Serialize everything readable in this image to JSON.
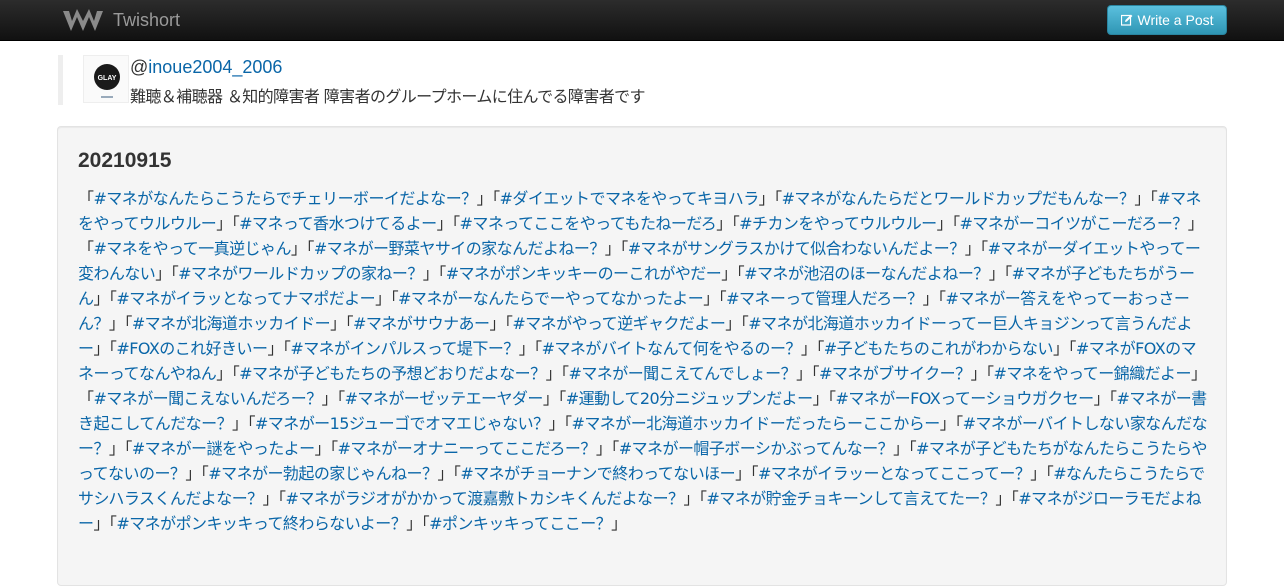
{
  "navbar": {
    "brand": "Twishort",
    "write_button": "Write a Post"
  },
  "profile": {
    "at": "@",
    "username": "inoue2004_2006",
    "bio": "難聴＆補聴器 ＆知的障害者 障害者のグループホームに住んでる障害者です",
    "avatar_text": "GLAY"
  },
  "post": {
    "title": "20210915",
    "segments": [
      {
        "t": "「"
      },
      {
        "t": "#マネがなんたらこうたらでチェリーボーイだよなー？",
        "link": true
      },
      {
        "t": "」「"
      },
      {
        "t": "#ダイエットでマネをやってキヨハラ",
        "link": true
      },
      {
        "t": "」「"
      },
      {
        "t": "#マネがなんたらだとワールドカップだもんなー？",
        "link": true
      },
      {
        "t": "」「"
      },
      {
        "t": "#マネをやってウルウルー",
        "link": true
      },
      {
        "t": "」「"
      },
      {
        "t": "#マネって香水つけてるよー",
        "link": true
      },
      {
        "t": "」「"
      },
      {
        "t": "#マネってここをやってもたねーだろ",
        "link": true
      },
      {
        "t": "」「"
      },
      {
        "t": "#チカンをやってウルウルー",
        "link": true
      },
      {
        "t": "」「"
      },
      {
        "t": "#マネがーコイツがこーだろー？",
        "link": true
      },
      {
        "t": "」「"
      },
      {
        "t": "#マネをやって一真逆じゃん",
        "link": true
      },
      {
        "t": "」「"
      },
      {
        "t": "#マネがー野菜ヤサイの家なんだよねー？",
        "link": true
      },
      {
        "t": "」「"
      },
      {
        "t": "#マネがサングラスかけて似合わないんだよー？",
        "link": true
      },
      {
        "t": "」「"
      },
      {
        "t": "#マネがーダイエットやってー変わんない",
        "link": true
      },
      {
        "t": "」「"
      },
      {
        "t": "#マネがワールドカップの家ねー？",
        "link": true
      },
      {
        "t": "」「"
      },
      {
        "t": "#マネがポンキッキーのーこれがやだー",
        "link": true
      },
      {
        "t": "」「"
      },
      {
        "t": "#マネが池沼のほーなんだよねー？",
        "link": true
      },
      {
        "t": "」「"
      },
      {
        "t": "#マネが子どもたちがうーん",
        "link": true
      },
      {
        "t": "」「"
      },
      {
        "t": "#マネがイラッとなってナマポだよー",
        "link": true
      },
      {
        "t": "」「"
      },
      {
        "t": "#マネがーなんたらでーやってなかったよー",
        "link": true
      },
      {
        "t": "」「"
      },
      {
        "t": "#マネーって管理人だろー？",
        "link": true
      },
      {
        "t": "」「"
      },
      {
        "t": "#マネがー答えをやってーおっさーん？",
        "link": true
      },
      {
        "t": "」「"
      },
      {
        "t": "#マネが北海道ホッカイドー",
        "link": true
      },
      {
        "t": "」「"
      },
      {
        "t": "#マネがサウナあー",
        "link": true
      },
      {
        "t": "」「"
      },
      {
        "t": "#マネがやって逆ギャクだよー",
        "link": true
      },
      {
        "t": "」「"
      },
      {
        "t": "#マネが北海道ホッカイドーってー巨人キョジンって言うんだよー",
        "link": true
      },
      {
        "t": "」「"
      },
      {
        "t": "#FOXのこれ好きいー",
        "link": true
      },
      {
        "t": "」「"
      },
      {
        "t": "#マネがインパルスって堤下ー？",
        "link": true
      },
      {
        "t": "」「"
      },
      {
        "t": "#マネがバイトなんて何をやるのー？",
        "link": true
      },
      {
        "t": "」「"
      },
      {
        "t": "#子どもたちのこれがわからない",
        "link": true
      },
      {
        "t": "」「"
      },
      {
        "t": "#マネがFOXのマネーってなんやねん",
        "link": true
      },
      {
        "t": "」「"
      },
      {
        "t": "#マネが子どもたちの予想どおりだよなー？",
        "link": true
      },
      {
        "t": "」「"
      },
      {
        "t": "#マネがー聞こえてんでしょー？",
        "link": true
      },
      {
        "t": "」「"
      },
      {
        "t": "#マネがブサイクー？",
        "link": true
      },
      {
        "t": "」「"
      },
      {
        "t": "#マネをやってー錦織だよー",
        "link": true
      },
      {
        "t": "」「"
      },
      {
        "t": "#マネがー聞こえないんだろー？",
        "link": true
      },
      {
        "t": "」「"
      },
      {
        "t": "#マネがーゼッテエーヤダー",
        "link": true
      },
      {
        "t": "」「"
      },
      {
        "t": "#運動して20分ニジュップンだよー",
        "link": true
      },
      {
        "t": "」「"
      },
      {
        "t": "#マネがーFOXってーショウガクセー",
        "link": true
      },
      {
        "t": "」「"
      },
      {
        "t": "#マネがー書き起こしてんだなー？",
        "link": true
      },
      {
        "t": "」「"
      },
      {
        "t": "#マネがー15ジューゴでオマエじゃない？",
        "link": true
      },
      {
        "t": "」「"
      },
      {
        "t": "#マネがー北海道ホッカイドーだったらーここからー",
        "link": true
      },
      {
        "t": "」「"
      },
      {
        "t": "#マネがーバイトしない家なんだなー？",
        "link": true
      },
      {
        "t": "」「"
      },
      {
        "t": "#マネがー謎をやったよー",
        "link": true
      },
      {
        "t": "」「"
      },
      {
        "t": "#マネがーオナニーってここだろー？",
        "link": true
      },
      {
        "t": "」「"
      },
      {
        "t": "#マネがー帽子ボーシかぶってんなー？",
        "link": true
      },
      {
        "t": "」「"
      },
      {
        "t": "#マネが子どもたちがなんたらこうたらやってないのー？",
        "link": true
      },
      {
        "t": "」「"
      },
      {
        "t": "#マネがー勃起の家じゃんねー？",
        "link": true
      },
      {
        "t": "」「"
      },
      {
        "t": "#マネがチョーナンで終わってないほー",
        "link": true
      },
      {
        "t": "」「"
      },
      {
        "t": "#マネがイラッーとなってここってー？",
        "link": true
      },
      {
        "t": "」「"
      },
      {
        "t": "#なんたらこうたらでサシハラスくんだよなー？",
        "link": true
      },
      {
        "t": "」「"
      },
      {
        "t": "#マネがラジオがかかって渡嘉敷トカシキくんだよなー？",
        "link": true
      },
      {
        "t": "」「"
      },
      {
        "t": "#マネが貯金チョキーンして言えてたー？",
        "link": true
      },
      {
        "t": "」「"
      },
      {
        "t": "#マネがジローラモだよねー",
        "link": true
      },
      {
        "t": "」「"
      },
      {
        "t": "#マネがポンキッキって終わらないよー？",
        "link": true
      },
      {
        "t": "」「"
      },
      {
        "t": "#ポンキッキってここー？",
        "link": true
      },
      {
        "t": "」"
      }
    ]
  },
  "colors": {
    "link": "#0a66a8",
    "navbar": "#1b1b1b",
    "button": "#49afcd"
  },
  "icons": {
    "logo": "twishort-logo-icon",
    "write": "edit-icon"
  }
}
